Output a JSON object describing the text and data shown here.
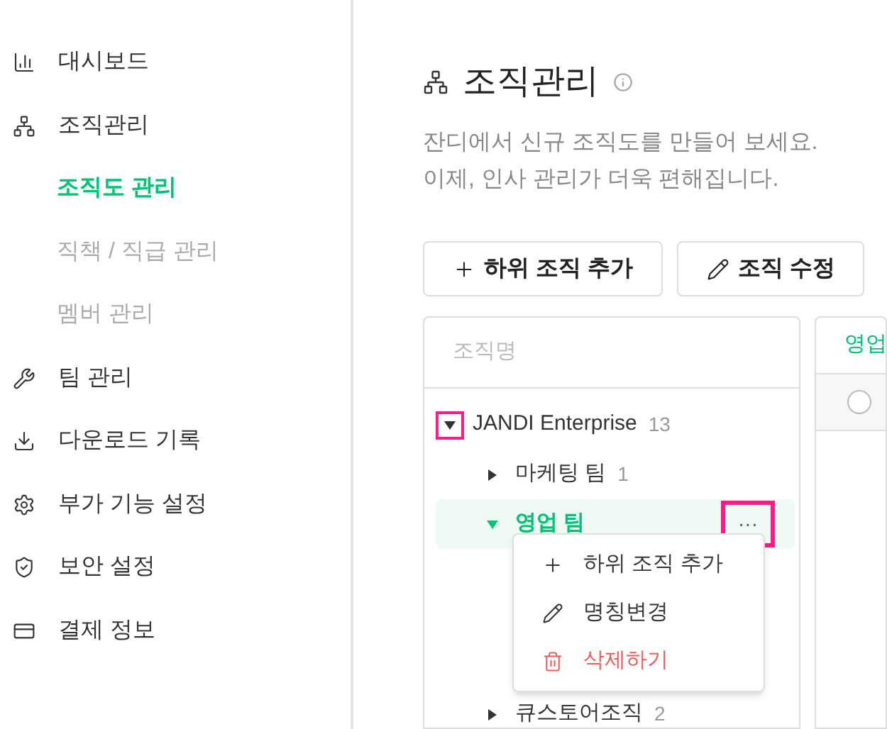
{
  "sidebar": {
    "items": [
      {
        "kind": "dashboard",
        "label": "대시보드",
        "selected": false
      },
      {
        "kind": "org",
        "label": "조직관리",
        "selected": false,
        "children": [
          {
            "label": "조직도 관리",
            "selected": true
          },
          {
            "label": "직책 / 직급 관리",
            "selected": false
          },
          {
            "label": "멤버 관리",
            "selected": false
          }
        ]
      },
      {
        "kind": "wrench",
        "label": "팀 관리",
        "selected": false
      },
      {
        "kind": "download",
        "label": "다운로드 기록",
        "selected": false
      },
      {
        "kind": "gear",
        "label": "부가 기능 설정",
        "selected": false
      },
      {
        "kind": "shield",
        "label": "보안 설정",
        "selected": false
      },
      {
        "kind": "card",
        "label": "결제 정보",
        "selected": false
      }
    ]
  },
  "page": {
    "title": "조직관리",
    "description": [
      "잔디에서 신규 조직도를 만들어 보세요.",
      "이제, 인사 관리가 더욱 편해집니다."
    ],
    "buttons": [
      {
        "kind": "plus",
        "label": "하위 조직 추가"
      },
      {
        "kind": "pencil",
        "label": "조직 수정"
      }
    ]
  },
  "tree": {
    "header": "조직명",
    "nodes": [
      {
        "label": "JANDI Enterprise",
        "count": "13",
        "expanded": true,
        "selected": false,
        "highlighted": true,
        "children": [
          {
            "label": "마케팅 팀",
            "count": "1",
            "expanded": false,
            "selected": false,
            "highlighted": false
          },
          {
            "label": "영업 팀",
            "expanded": true,
            "selected": true,
            "highlighted": false,
            "more_label": "···",
            "more_highlighted": true
          },
          {
            "label": "큐스토어조직",
            "count": "2",
            "expanded": false,
            "selected": false,
            "highlighted": false
          }
        ]
      }
    ]
  },
  "context_menu": {
    "items": [
      {
        "kind": "plus",
        "label": "하위 조직 추가",
        "danger": false
      },
      {
        "kind": "pencil",
        "label": "명칭변경",
        "danger": false
      },
      {
        "kind": "trash",
        "label": "삭제하기",
        "danger": true
      }
    ]
  },
  "detail": {
    "header": "영업",
    "radio_selected": false
  }
}
